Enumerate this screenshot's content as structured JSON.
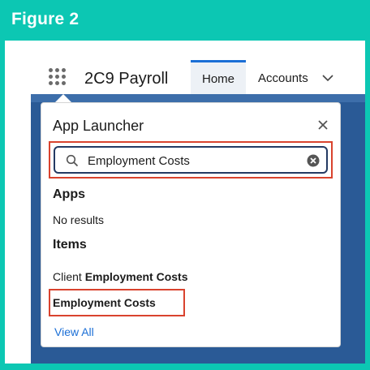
{
  "figure": {
    "title": "Figure 2"
  },
  "header": {
    "app_name": "2C9 Payroll",
    "tabs": [
      {
        "label": "Home",
        "active": true
      },
      {
        "label": "Accounts",
        "active": false
      }
    ]
  },
  "launcher": {
    "title": "App Launcher",
    "search": {
      "value": "Employment Costs"
    },
    "apps_heading": "Apps",
    "apps_empty": "No results",
    "items_heading": "Items",
    "items": [
      {
        "prefix": "Client ",
        "match": "Employment Costs"
      },
      {
        "prefix": "",
        "match": "Employment Costs"
      }
    ],
    "view_all": "View All"
  },
  "colors": {
    "frame": "#0cc7b3",
    "highlight": "#d9432e",
    "active_tab_accent": "#1b6fd6",
    "link": "#1b6fd6",
    "search_border": "#243a63"
  },
  "icons": [
    "app-launcher-waffle-icon",
    "chevron-down-icon",
    "close-icon",
    "search-icon",
    "clear-icon"
  ]
}
